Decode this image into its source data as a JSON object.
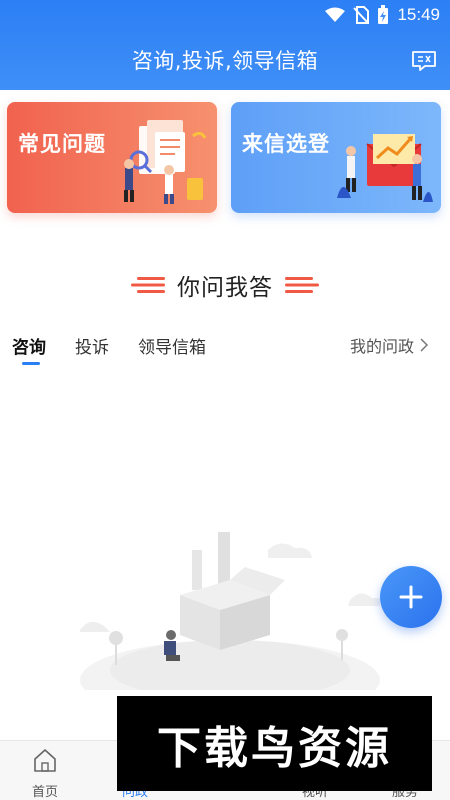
{
  "status_bar": {
    "time": "15:49"
  },
  "header": {
    "title": "咨询,投诉,领导信箱",
    "chat_icon": "chat-bubble-icon"
  },
  "cards": [
    {
      "label": "常见问题",
      "color_from": "#f1624f",
      "color_to": "#f6916e"
    },
    {
      "label": "来信选登",
      "color_from": "#5e9ff7",
      "color_to": "#7db7fb"
    }
  ],
  "section": {
    "title": "你问我答"
  },
  "tabs": [
    {
      "label": "咨询",
      "active": true
    },
    {
      "label": "投诉",
      "active": false
    },
    {
      "label": "领导信箱",
      "active": false
    }
  ],
  "my_link": {
    "label": "我的问政"
  },
  "fab": {
    "icon": "plus-icon"
  },
  "bottom_nav": [
    {
      "label": "首页",
      "icon": "home-icon"
    },
    {
      "label": "问政",
      "icon": "question-icon",
      "active": true
    },
    {
      "label": "视听",
      "icon": "video-icon"
    },
    {
      "label": "服务",
      "icon": "service-icon"
    }
  ],
  "watermark": {
    "text": "下载鸟资源"
  },
  "accent_color": "#2a7ff5"
}
